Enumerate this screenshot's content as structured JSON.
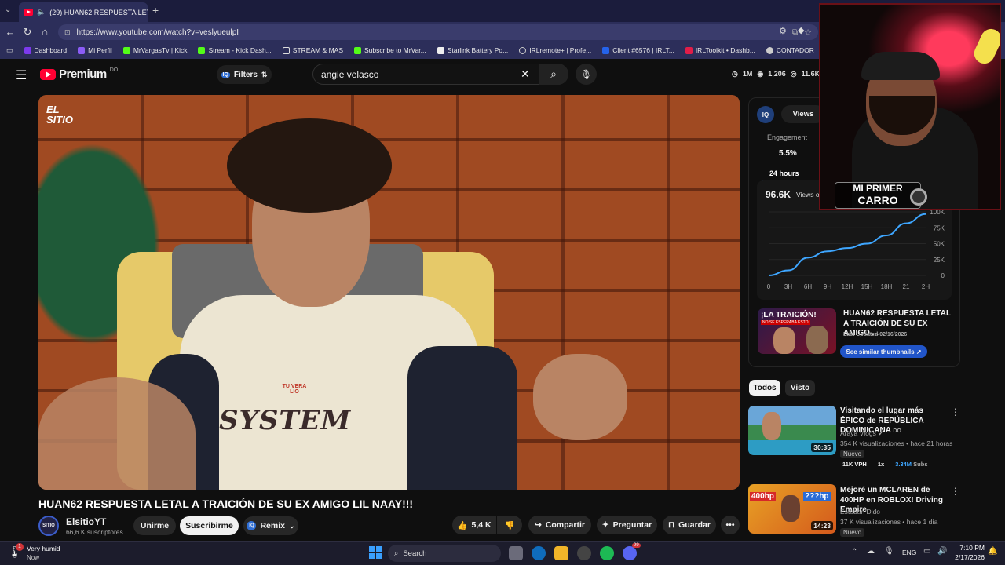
{
  "browser": {
    "tab_title": "(29) HUAN62 RESPUESTA LETAL A",
    "url": "https://www.youtube.com/watch?v=veslyueulpI",
    "bookmarks": [
      "Dashboard",
      "Mi Perfil",
      "MrVargasTv | Kick",
      "Stream - Kick Dash...",
      "STREAM & MAS",
      "Subscribe to MrVar...",
      "Starlink Battery Po...",
      "IRLremote+ | Profe...",
      "Client #6576 | IRLT...",
      "IRLToolkit • Dashb...",
      "CONTADOR"
    ],
    "bookmark_colors": [
      "#7c3aed",
      "#8b5cf6",
      "#53fc18",
      "#53fc18",
      "#f5c542",
      "#53fc18",
      "#eeeeee",
      "#aaaaaa",
      "#2563eb",
      "#e11d48",
      "#cccccc"
    ]
  },
  "youtube": {
    "logo_text": "Premium",
    "logo_sup": "DO",
    "filters_label": "Filters",
    "search_value": "angie velasco",
    "header_stats": [
      "1M",
      "1,206",
      "11.6K"
    ]
  },
  "video": {
    "watermark": "EL SITIO",
    "shirt_text": "SYSTEM",
    "pendant_text": "TU VERA LIO",
    "title": "HUAN62 RESPUESTA LETAL A TRAICIÓN DE SU EX AMIGO LIL NAAY!!!",
    "channel_name": "ElsitioYT",
    "subscribers": "66,6 K suscriptores",
    "avatar_text": "SITIO",
    "join_label": "Unirme",
    "subscribe_label": "Suscribirme",
    "remix_label": "Remix",
    "likes": "5,4 K",
    "share_label": "Compartir",
    "ask_label": "Preguntar",
    "save_label": "Guardar"
  },
  "analytics": {
    "iq_badge": "IQ",
    "views_tab": "Views",
    "engagement_label": "Engagement",
    "engagement_value": "5.5%",
    "period_tab": "24 hours",
    "views_value": "96.6K",
    "views_suffix": "Views o",
    "related_title": "HUAN62 RESPUESTA LETAL A TRAICIÓN DE SU EX AMIGO ...",
    "last_updated": "Last Updated 02/16/2026",
    "similar_button": "See similar thumbnails ↗",
    "thumb_banner": "¡LA TRAICIÓN!",
    "thumb_sub": "NO SE ESPERABA ESTO"
  },
  "chart_data": {
    "type": "line",
    "x": [
      "0",
      "3H",
      "6H",
      "9H",
      "12H",
      "15H",
      "18H",
      "21H",
      "24H"
    ],
    "xlabels": [
      "0",
      "3H",
      "6H",
      "9H",
      "12H",
      "15H",
      "18H",
      "21",
      "2H"
    ],
    "y": [
      0,
      8000,
      28000,
      38000,
      43000,
      50000,
      63000,
      82000,
      96600
    ],
    "ylim": [
      0,
      100000
    ],
    "yticks": [
      "100K",
      "75K",
      "50K",
      "25K",
      "0"
    ],
    "yticks_values": [
      100000,
      75000,
      50000,
      25000,
      0
    ],
    "color": "#3ea6ff"
  },
  "filter_chips": [
    "Todos",
    "Visto"
  ],
  "recommendations": [
    {
      "title": "Visitando el lugar más ÉPICO de REPÚBLICA DOMINICANA",
      "title_suffix": "DO",
      "channel": "Araya Vlogs",
      "meta": "354 K visualizaciones • hace 21 horas",
      "badge": "Nuevo",
      "duration": "30:35",
      "vph": "11K VPH",
      "speed": "1x",
      "subs": "3.34M",
      "subs_suffix": "Subs"
    },
    {
      "title": "Mejoré un MCLAREN de 400HP en ROBLOX! Driving Empire",
      "channel": "Esteban Dido",
      "meta": "37 K visualizaciones • hace 1 día",
      "badge": "Nuevo",
      "duration": "14:23",
      "thumb_text_a": "400hp",
      "thumb_text_b": "???hp"
    }
  ],
  "webcam": {
    "overlay_line1": "MI PRIMER",
    "overlay_line2": "CARRO"
  },
  "taskbar": {
    "weather_title": "Very humid",
    "weather_sub": "Now",
    "weather_badge": "1",
    "search_label": "Search",
    "discord_badge": "99",
    "language": "ENG",
    "time": "7:10 PM",
    "date": "2/17/2026"
  }
}
